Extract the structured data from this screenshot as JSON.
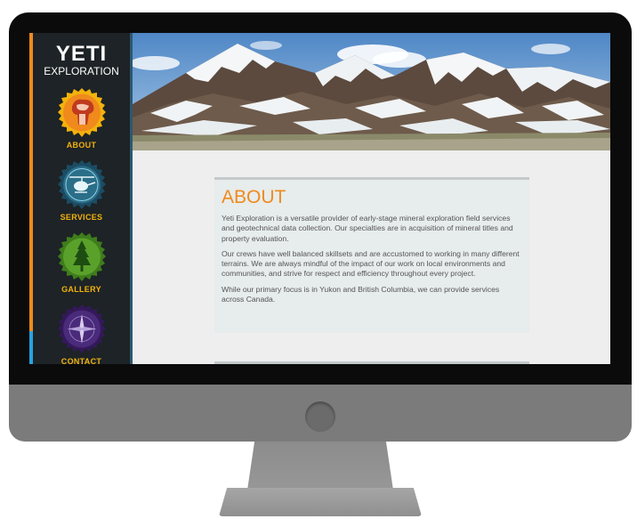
{
  "site": {
    "title": "YETI",
    "subtitle": "EXPLORATION"
  },
  "nav": [
    {
      "label": "ABOUT",
      "icon": "yeti-head-icon",
      "color": "#f08a1c"
    },
    {
      "label": "SERVICES",
      "icon": "helicopter-icon",
      "color": "#2b6e88"
    },
    {
      "label": "GALLERY",
      "icon": "tree-icon",
      "color": "#5aa12b"
    },
    {
      "label": "CONTACT",
      "icon": "compass-icon",
      "color": "#4a2a7a"
    }
  ],
  "about": {
    "heading": "ABOUT",
    "paragraphs": [
      "Yeti Exploration is a versatile provider of early-stage mineral exploration field services and geotechnical data collection. Our specialties are in acquisition of mineral titles and property evaluation.",
      "Our crews have well balanced skillsets and are accustomed to working in many different terrains. We are always mindful of the impact of our work on local environments and communities, and strive for respect and efficiency throughout every project.",
      "While our primary focus is in Yukon and British Columbia, we can provide services across Canada."
    ]
  },
  "colors": {
    "accent": "#f08a1c",
    "nav_label": "#f3b20c",
    "sidebar_bg": "#1d2326"
  }
}
